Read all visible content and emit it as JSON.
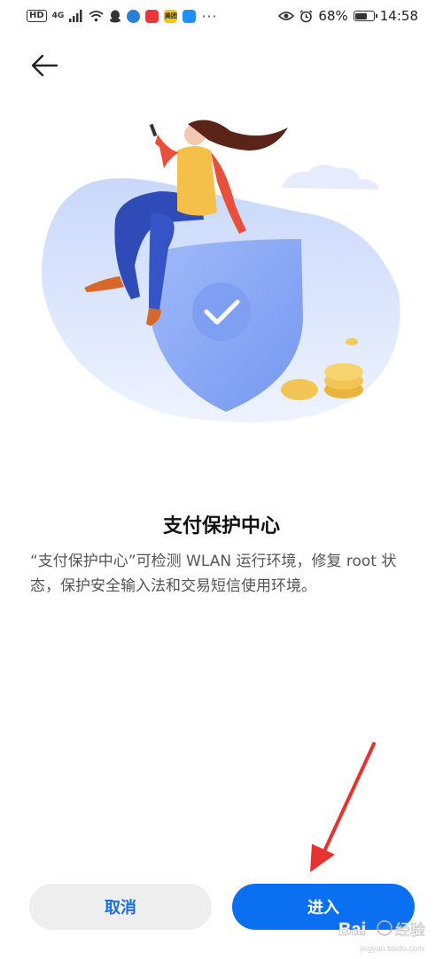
{
  "status_bar": {
    "hd": "HD",
    "network": "4G",
    "app_badge": "美团",
    "more": "···",
    "battery": "68%",
    "battery_level": 0.68,
    "time": "14:58"
  },
  "main": {
    "title": "支付保护中心",
    "description": "“支付保护中心”可检测 WLAN 运行环境，修复 root 状态，保护安全输入法和交易短信使用环境。"
  },
  "buttons": {
    "cancel": "取消",
    "enter": "进入"
  },
  "watermark": {
    "brand": "Bai",
    "brand_cn": "经验",
    "url": "jingyan.baidu.com"
  },
  "colors": {
    "primary": "#0a6ff1",
    "cancel_bg": "#eeeeee",
    "arrow": "#e8322f"
  }
}
